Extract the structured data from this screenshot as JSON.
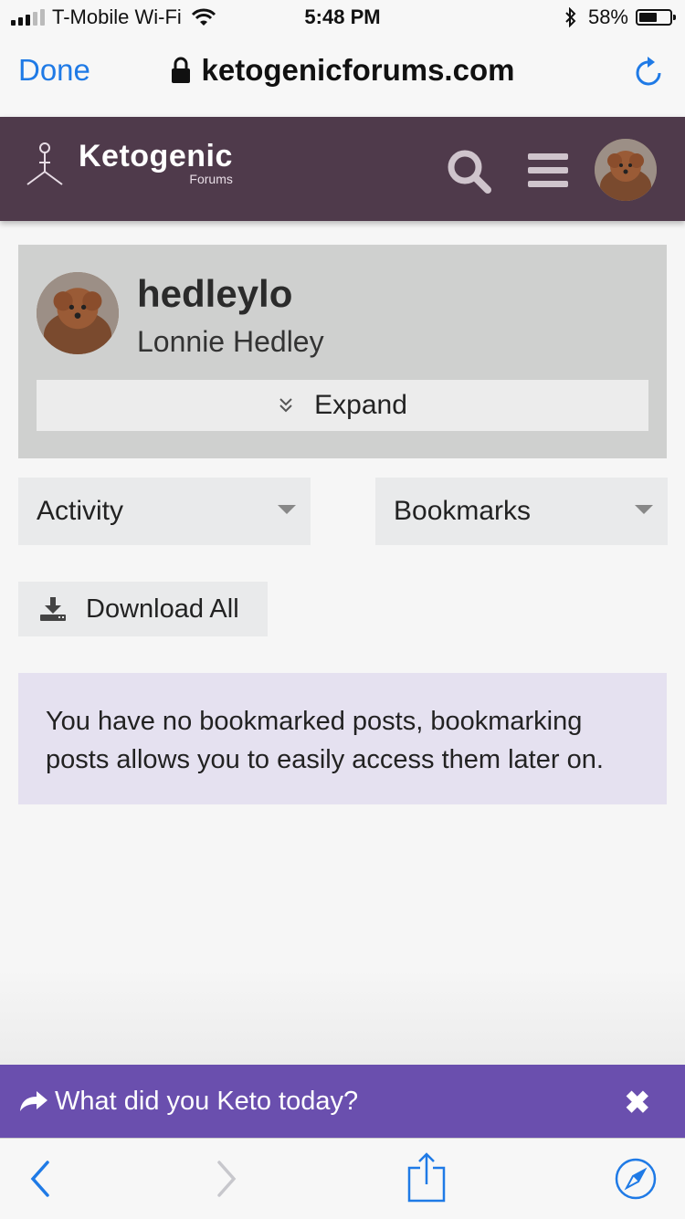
{
  "status_bar": {
    "carrier": "T-Mobile Wi-Fi",
    "time": "5:48 PM",
    "battery_pct": "58%",
    "battery_level": 0.58
  },
  "browser": {
    "done_label": "Done",
    "url": "ketogenicforums.com"
  },
  "site": {
    "logo_title": "Ketogenic",
    "logo_subtitle": "Forums",
    "colors": {
      "header_bg": "#4f3a4b",
      "accent": "#6a4fae",
      "link": "#1f7ae6"
    }
  },
  "profile": {
    "username": "hedleylo",
    "full_name": "Lonnie Hedley",
    "expand_label": "Expand"
  },
  "filters": {
    "activity": {
      "selected": "Activity"
    },
    "bookmarks": {
      "selected": "Bookmarks"
    }
  },
  "download_label": "Download All",
  "notice_text": "You have no bookmarked posts, bookmarking posts allows you to easily access them later on.",
  "promo": {
    "text": "What did you Keto today?",
    "close": "✖"
  },
  "icons": [
    "signal-icon",
    "wifi-icon",
    "bluetooth-icon",
    "battery-icon",
    "lock-icon",
    "reload-icon",
    "logo-icon",
    "search-icon",
    "menu-icon",
    "avatar",
    "chevron-double-down-icon",
    "caret-down-icon",
    "download-icon",
    "share-arrow-icon",
    "close-icon",
    "back-icon",
    "forward-icon",
    "share-icon",
    "compass-icon"
  ]
}
